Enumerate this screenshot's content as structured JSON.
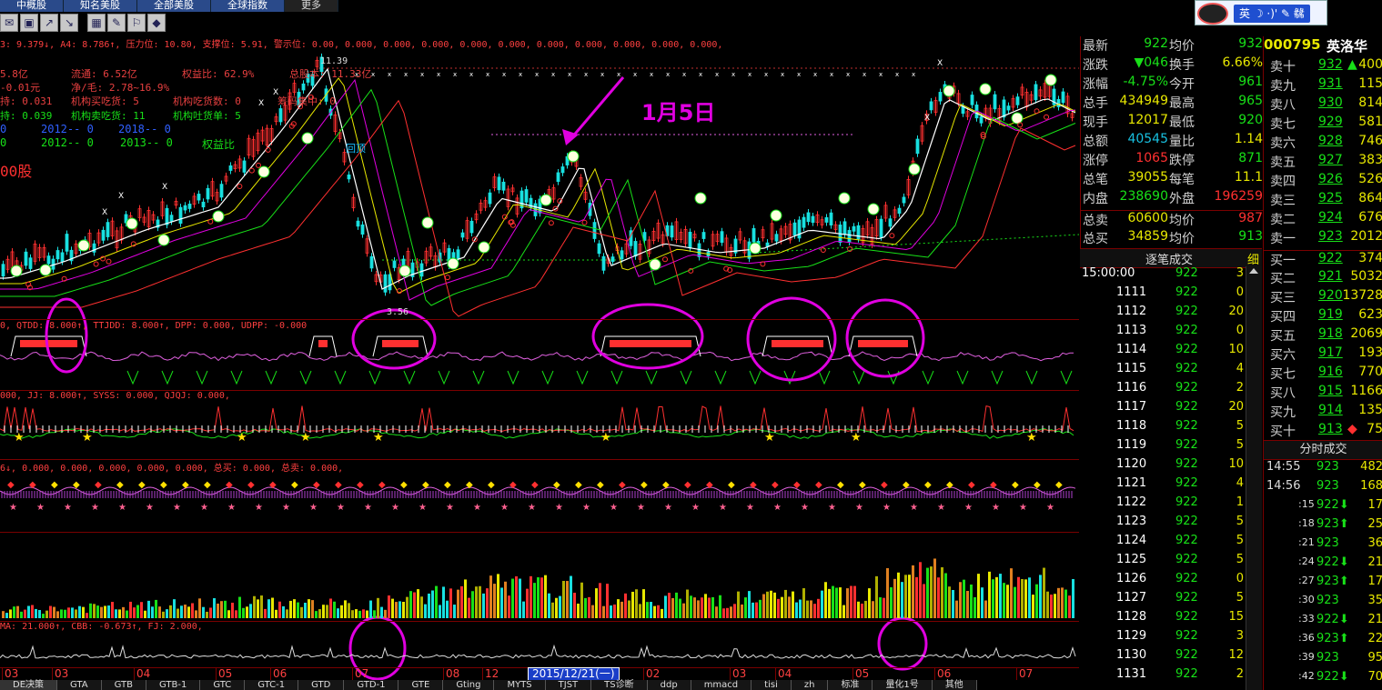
{
  "tabs": [
    "中概股",
    "知名美股",
    "全部美股",
    "全球指数",
    "更多"
  ],
  "toolbar": [
    "mail-icon",
    "image-icon",
    "chart-up-icon",
    "chart-down-icon",
    "calc-icon",
    "message-icon",
    "broadcast-icon",
    "diamond-icon"
  ],
  "qq": {
    "ime": "英 ☽ ·)' ✎ 㣈"
  },
  "indicators": {
    "main": "3: 9.379↓, A4: 8.786↑, 压力位: 10.80, 支撑位: 5.91, 警示位: 0.00, 0.000, 0.000, 0.000, 0.000, 0.000, 0.000, 0.000, 0.000, 0.000, 0.000,",
    "info": [
      {
        "a": "5.8亿",
        "b": "流通: 6.52亿",
        "c": "权益比: 62.9%",
        "d": "总股本: 11.33亿"
      },
      {
        "a": "-0.01元",
        "b": "净/毛: 2.78~16.9%"
      },
      {
        "a": "持: 0.031",
        "b": "机构买吃货: 5",
        "c": "机构吃货数: 0",
        "d": "筹码集中: 0"
      },
      {
        "a": "持: 0.039",
        "b": "机构卖吃货: 11",
        "c": "机构吐货单: 5"
      },
      {
        "a": "0",
        "b": "2012-- 0",
        "c": "2018-- 0"
      },
      {
        "a": "0",
        "b": "2012-- 0",
        "c": "2013-- 0",
        "d": "权益比"
      }
    ],
    "shares": "00股",
    "panel2": "0, QTDD: 8.000↑, TTJDD: 8.000↑, DPP: 0.000, UDPP: -0.000",
    "panel3": "000, JJ: 8.000↑, SYSS: 0.000, QJQJ: 0.000,",
    "panel4": "6↓, 0.000, 0.000, 0.000, 0.000, 0.000, 总买: 0.000, 总卖: 0.000,",
    "panel6": "MA: 21.000↑, CBB: -0.673↑, FJ: 2.000,"
  },
  "annotations": {
    "date_label": "1月5日",
    "high": "11.39",
    "low": "3.56",
    "tag": "回顶"
  },
  "chart_axis": {
    "months": [
      "03",
      "03",
      "04",
      "05",
      "06",
      "07",
      "08",
      "12",
      "02",
      "03",
      "04",
      "05",
      "06",
      "07"
    ],
    "cursor_date": "2015/12/21(一)"
  },
  "quote": {
    "rows": [
      {
        "l": "最新",
        "v": "922",
        "vc": "#18e018",
        "l2": "均价",
        "v2": "932",
        "v2c": "#18e018"
      },
      {
        "l": "涨跌",
        "v": "▼046",
        "vc": "#18e018",
        "l2": "换手",
        "v2": "6.66%",
        "v2c": "#e8e800"
      },
      {
        "l": "涨幅",
        "v": "-4.75%",
        "vc": "#18e018",
        "l2": "今开",
        "v2": "961",
        "v2c": "#18e018"
      },
      {
        "l": "总手",
        "v": "434949",
        "vc": "#e8e800",
        "l2": "最高",
        "v2": "965",
        "v2c": "#18e018"
      },
      {
        "l": "现手",
        "v": "12017",
        "vc": "#e8e800",
        "l2": "最低",
        "v2": "920",
        "v2c": "#18e018"
      },
      {
        "l": "总额",
        "v": "40545",
        "vc": "#18c0e0",
        "l2": "量比",
        "v2": "1.14",
        "v2c": "#e8e800"
      },
      {
        "l": "涨停",
        "v": "1065",
        "vc": "#ff3030",
        "l2": "跌停",
        "v2": "871",
        "v2c": "#18e018"
      },
      {
        "l": "总笔",
        "v": "39055",
        "vc": "#e8e800",
        "l2": "每笔",
        "v2": "11.1",
        "v2c": "#e8e800"
      },
      {
        "l": "内盘",
        "v": "238690",
        "vc": "#18e018",
        "l2": "外盘",
        "v2": "196259",
        "v2c": "#ff3030"
      },
      {
        "l": "总卖",
        "v": "60600",
        "vc": "#e8e800",
        "l2": "均价",
        "v2": "987",
        "v2c": "#ff3030"
      },
      {
        "l": "总买",
        "v": "34859",
        "vc": "#e8e800",
        "l2": "均价",
        "v2": "913",
        "v2c": "#18e018"
      }
    ]
  },
  "trades": {
    "title": "逐笔成交",
    "fine": "细",
    "rows": [
      {
        "t": "15:00:00",
        "p": "922",
        "n": "3"
      },
      {
        "t": "1111",
        "p": "922",
        "n": "0"
      },
      {
        "t": "1112",
        "p": "922",
        "n": "20"
      },
      {
        "t": "1113",
        "p": "922",
        "n": "0"
      },
      {
        "t": "1114",
        "p": "922",
        "n": "10"
      },
      {
        "t": "1115",
        "p": "922",
        "n": "4"
      },
      {
        "t": "1116",
        "p": "922",
        "n": "2"
      },
      {
        "t": "1117",
        "p": "922",
        "n": "20"
      },
      {
        "t": "1118",
        "p": "922",
        "n": "5"
      },
      {
        "t": "1119",
        "p": "922",
        "n": "5"
      },
      {
        "t": "1120",
        "p": "922",
        "n": "10"
      },
      {
        "t": "1121",
        "p": "922",
        "n": "4"
      },
      {
        "t": "1122",
        "p": "922",
        "n": "1"
      },
      {
        "t": "1123",
        "p": "922",
        "n": "5"
      },
      {
        "t": "1124",
        "p": "922",
        "n": "5"
      },
      {
        "t": "1125",
        "p": "922",
        "n": "5"
      },
      {
        "t": "1126",
        "p": "922",
        "n": "0"
      },
      {
        "t": "1127",
        "p": "922",
        "n": "5"
      },
      {
        "t": "1128",
        "p": "922",
        "n": "15"
      },
      {
        "t": "1129",
        "p": "922",
        "n": "3"
      },
      {
        "t": "1130",
        "p": "922",
        "n": "12"
      },
      {
        "t": "1131",
        "p": "922",
        "n": "2"
      }
    ]
  },
  "book": {
    "code": "000795",
    "name": "英洛华",
    "sells": [
      {
        "l": "卖十",
        "p": "932",
        "q": "400",
        "arrow": "▲"
      },
      {
        "l": "卖九",
        "p": "931",
        "q": "115"
      },
      {
        "l": "卖八",
        "p": "930",
        "q": "814"
      },
      {
        "l": "卖七",
        "p": "929",
        "q": "581"
      },
      {
        "l": "卖六",
        "p": "928",
        "q": "746"
      },
      {
        "l": "卖五",
        "p": "927",
        "q": "383"
      },
      {
        "l": "卖四",
        "p": "926",
        "q": "526"
      },
      {
        "l": "卖三",
        "p": "925",
        "q": "864"
      },
      {
        "l": "卖二",
        "p": "924",
        "q": "676"
      },
      {
        "l": "卖一",
        "p": "923",
        "q": "2012"
      }
    ],
    "buys": [
      {
        "l": "买一",
        "p": "922",
        "q": "374"
      },
      {
        "l": "买二",
        "p": "921",
        "q": "5032"
      },
      {
        "l": "买三",
        "p": "920",
        "q": "13728"
      },
      {
        "l": "买四",
        "p": "919",
        "q": "623"
      },
      {
        "l": "买五",
        "p": "918",
        "q": "2069"
      },
      {
        "l": "买六",
        "p": "917",
        "q": "193"
      },
      {
        "l": "买七",
        "p": "916",
        "q": "770"
      },
      {
        "l": "买八",
        "p": "915",
        "q": "1166"
      },
      {
        "l": "买九",
        "p": "914",
        "q": "135"
      },
      {
        "l": "买十",
        "p": "913",
        "q": "75",
        "arrow": "◆"
      }
    ]
  },
  "minute": {
    "title": "分时成交",
    "rows": [
      {
        "t": "14:55",
        "p": "923",
        "q": "482"
      },
      {
        "t": "14:56",
        "p": "923",
        "q": "168"
      },
      {
        "t": ":15",
        "p": "922⬇",
        "q": "17"
      },
      {
        "t": ":18",
        "p": "923⬆",
        "q": "25"
      },
      {
        "t": ":21",
        "p": "923",
        "q": "36"
      },
      {
        "t": ":24",
        "p": "922⬇",
        "q": "21"
      },
      {
        "t": ":27",
        "p": "923⬆",
        "q": "17"
      },
      {
        "t": ":30",
        "p": "923",
        "q": "35"
      },
      {
        "t": ":33",
        "p": "922⬇",
        "q": "21"
      },
      {
        "t": ":36",
        "p": "923⬆",
        "q": "22"
      },
      {
        "t": ":39",
        "p": "923",
        "q": "95"
      },
      {
        "t": ":42",
        "p": "922⬇",
        "q": "70"
      }
    ]
  },
  "bottom_tabs": [
    "DE决策",
    "GTA",
    "GTB",
    "GTB-1",
    "GTC",
    "GTC-1",
    "GTD",
    "GTD-1",
    "GTE",
    "Gting",
    "MYTS",
    "TJST",
    "TS诊断",
    "ddp",
    "mmacd",
    "tisi",
    "zh",
    "标准",
    "量化1号",
    "其他"
  ]
}
